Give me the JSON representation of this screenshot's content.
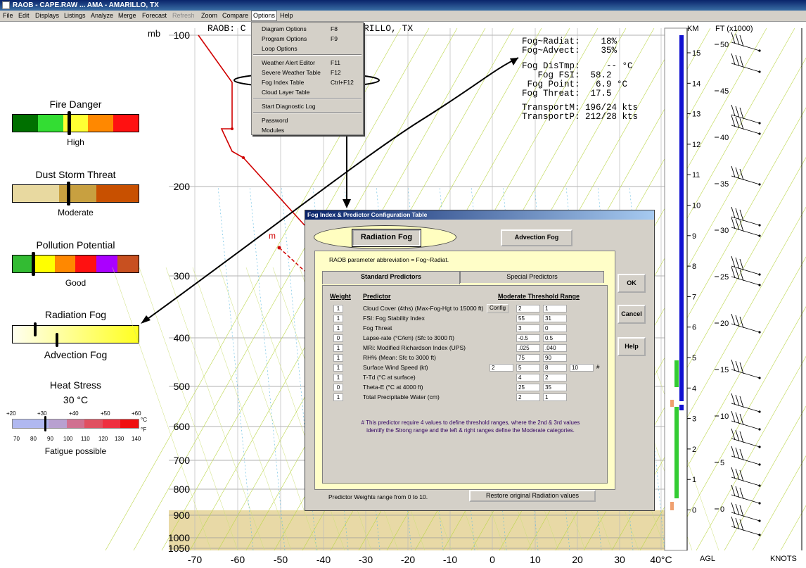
{
  "window": {
    "title": "RAOB - CAPE.RAW  ...  AMA - AMARILLO, TX"
  },
  "menu": [
    "File",
    "Edit",
    "Displays",
    "Listings",
    "Analyze",
    "Merge",
    "Forecast",
    "Refresh",
    "Zoom",
    "Compare",
    "Options",
    "Help"
  ],
  "options_menu": {
    "items": [
      {
        "label": "Diagram Options",
        "shortcut": "F8"
      },
      {
        "label": "Program Options",
        "shortcut": "F9"
      },
      {
        "label": "Loop Options",
        "shortcut": ""
      },
      {
        "label": "Weather Alert Editor",
        "shortcut": "F11"
      },
      {
        "label": "Severe Weather Table",
        "shortcut": "F12"
      },
      {
        "label": "Fog Index Table",
        "shortcut": "Ctrl+F12"
      },
      {
        "label": "Cloud Layer Table",
        "shortcut": ""
      },
      {
        "label": "Start Diagnostic Log",
        "shortcut": ""
      },
      {
        "label": "Password",
        "shortcut": ""
      },
      {
        "label": "Modules",
        "shortcut": ""
      }
    ]
  },
  "left_panel": {
    "fire": {
      "title": "Fire Danger",
      "label": "High",
      "marker": 0.45
    },
    "dust": {
      "title": "Dust Storm Threat",
      "label": "Moderate",
      "marker": 0.44
    },
    "pollution": {
      "title": "Pollution Potential",
      "label": "Good",
      "marker": 0.17
    },
    "fog": {
      "title": "Radiation Fog",
      "label": "Advection Fog",
      "radiation_marker": 0.18,
      "advection_marker": 0.36
    },
    "heat": {
      "title": "Heat Stress",
      "value": "30 °C",
      "label": "Fatigue possible",
      "c_ticks": [
        "+20",
        "+30",
        "+40",
        "+50",
        "+60"
      ],
      "f_ticks": [
        "70",
        "80",
        "90",
        "100",
        "110",
        "120",
        "130",
        "140"
      ],
      "c_unit": "°C",
      "f_unit": "°F"
    }
  },
  "chart": {
    "header": "RAOB:  C",
    "header2": "RILLO, TX",
    "mb_label": "mb",
    "pressure_ticks": [
      "100",
      "200",
      "300",
      "400",
      "500",
      "600",
      "700",
      "800",
      "900",
      "1000",
      "1050"
    ],
    "temp_ticks": [
      "-70",
      "-60",
      "-50",
      "-40",
      "-30",
      "-20",
      "-10",
      "0",
      "10",
      "20",
      "30",
      "40°C"
    ],
    "m_label": "m",
    "km_label": "KM",
    "ft_label": "FT (x1000)",
    "km_ticks": [
      "15",
      "14",
      "13",
      "12",
      "11",
      "10",
      "9",
      "8",
      "7",
      "6",
      "5",
      "4",
      "3",
      "2",
      "1",
      "0"
    ],
    "ft_ticks": [
      "50",
      "45",
      "40",
      "35",
      "30",
      "25",
      "20",
      "15",
      "10",
      "5",
      "0"
    ],
    "agl": "AGL",
    "knots": "KNOTS"
  },
  "info": {
    "fog_radiat": "Fog~Radiat:    18%",
    "fog_advect": "Fog~Advect:    35%",
    "fog_distmp": "Fog DisTmp:     -- °C",
    "fog_fsi": "   Fog FSI:  58.2",
    "fog_point": " Fog Point:   6.9 °C",
    "fog_threat": "Fog Threat:  17.5",
    "transport_m": "TransportM: 196/24 kts",
    "transport_p": "TransportP: 212/28 kts"
  },
  "dialog": {
    "title": "Fog Index & Predictor Configuration Table",
    "radiation_button": "Radiation Fog",
    "advection_button": "Advection Fog",
    "abbrev": "RAOB parameter abbreviation = Fog~Radiat.",
    "tab_standard": "Standard Predictors",
    "tab_special": "Special Predictors",
    "col_weight": "Weight",
    "col_predictor": "Predictor",
    "col_range": "Moderate Threshold Range",
    "config_button": "Config",
    "ok": "OK",
    "cancel": "Cancel",
    "help": "Help",
    "rows": [
      {
        "w": "1",
        "name": "Cloud Cover (4ths) (Max-Fog-Hgt to 15000 ft)",
        "a": "2",
        "b": "1"
      },
      {
        "w": "1",
        "name": "FSI: Fog Stability Index",
        "a": "55",
        "b": "31"
      },
      {
        "w": "1",
        "name": "Fog Threat",
        "a": "3",
        "b": "0"
      },
      {
        "w": "0",
        "name": "Lapse-rate (°C/km) (Sfc to 3000 ft)",
        "a": "-0.5",
        "b": "0.5"
      },
      {
        "w": "1",
        "name": "MRi: Modified Richardson Index (UPS)",
        "a": ".025",
        "b": ".040"
      },
      {
        "w": "1",
        "name": "RH% (Mean: Sfc to 3000 ft)",
        "a": "75",
        "b": "90"
      },
      {
        "w": "1",
        "name": "Surface Wind Speed (kt)",
        "pre": "2",
        "a": "5",
        "b": "8",
        "post": "10",
        "hash": "#"
      },
      {
        "w": "1",
        "name": "T-Td (°C at surface)",
        "a": "4",
        "b": "2"
      },
      {
        "w": "0",
        "name": "Theta-E (°C at 4000 ft)",
        "a": "25",
        "b": "35"
      },
      {
        "w": "1",
        "name": "Total Precipitable Water (cm)",
        "a": "2",
        "b": "1"
      }
    ],
    "note1": "# This predictor require 4 values to define threshold ranges, where the 2nd & 3rd values",
    "note2": "identify the Strong range and the left & right ranges define the Moderate categories.",
    "weights_note": "Predictor Weights range from 0 to 10.",
    "restore_button": "Restore original Radiation values"
  },
  "colors": {
    "fire": [
      "#007000",
      "#33dd33",
      "#ffff33",
      "#ff8800",
      "#ff1111"
    ],
    "dust": [
      "#e8d9a0",
      "#c8a040",
      "#c85000"
    ],
    "pollution": [
      "#33bb33",
      "#ffff00",
      "#ff8800",
      "#ff1111",
      "#aa00ff",
      "#c85020"
    ],
    "heat": [
      "#b0b8f0",
      "#b8a0d0",
      "#d07090",
      "#e05060",
      "#ee3040",
      "#f01010"
    ]
  }
}
